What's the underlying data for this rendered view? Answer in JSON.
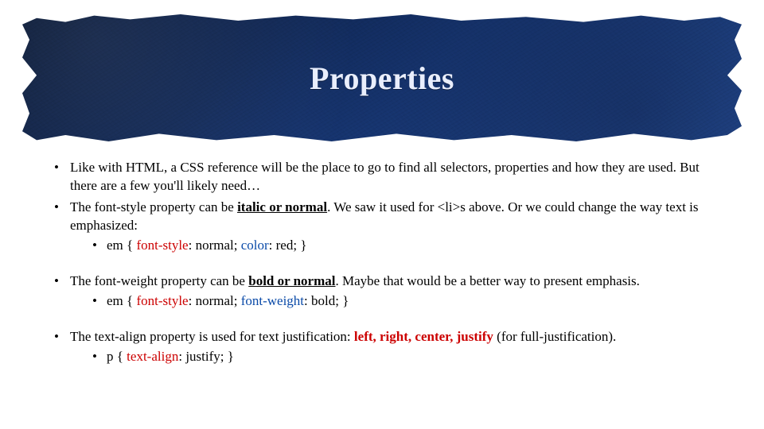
{
  "slide": {
    "title": "Properties",
    "bullets": [
      {
        "text": "Like with HTML, a CSS reference will be the place to go to find all selectors, properties and how they are used. But there are a few you'll likely need…"
      },
      {
        "prefix": "The font-style property can be ",
        "emph": "italic or normal",
        "suffix": ". We saw it used for <li>s above. Or we could change the way text is emphasized:",
        "code": {
          "sel": "em",
          "decls": [
            {
              "prop": "font-style",
              "val": "normal",
              "propColor": "red",
              "valColor": "black"
            },
            {
              "prop": "color",
              "val": "red",
              "propColor": "blue",
              "valColor": "black"
            }
          ]
        }
      },
      {
        "prefix": "The font-weight property can be ",
        "emph": "bold or normal",
        "suffix": ". Maybe that would be a better way to present emphasis.",
        "code": {
          "sel": "em",
          "decls": [
            {
              "prop": "font-style",
              "val": "normal",
              "propColor": "red",
              "valColor": "black"
            },
            {
              "prop": "font-weight",
              "val": "bold",
              "propColor": "blue",
              "valColor": "black"
            }
          ]
        }
      },
      {
        "prefix": "The text-align property is used for text justification: ",
        "emph": "left, right, center, justify",
        "emphColor": "red",
        "suffix": " (for full-justification).",
        "code": {
          "sel": "p",
          "decls": [
            {
              "prop": "text-align",
              "val": "justify",
              "propColor": "red",
              "valColor": "black"
            }
          ]
        }
      }
    ]
  },
  "colors": {
    "red": "#cc0000",
    "blue": "#0a4aa8",
    "bannerStart": "#0e1d3a",
    "bannerEnd": "#2a4f97"
  }
}
